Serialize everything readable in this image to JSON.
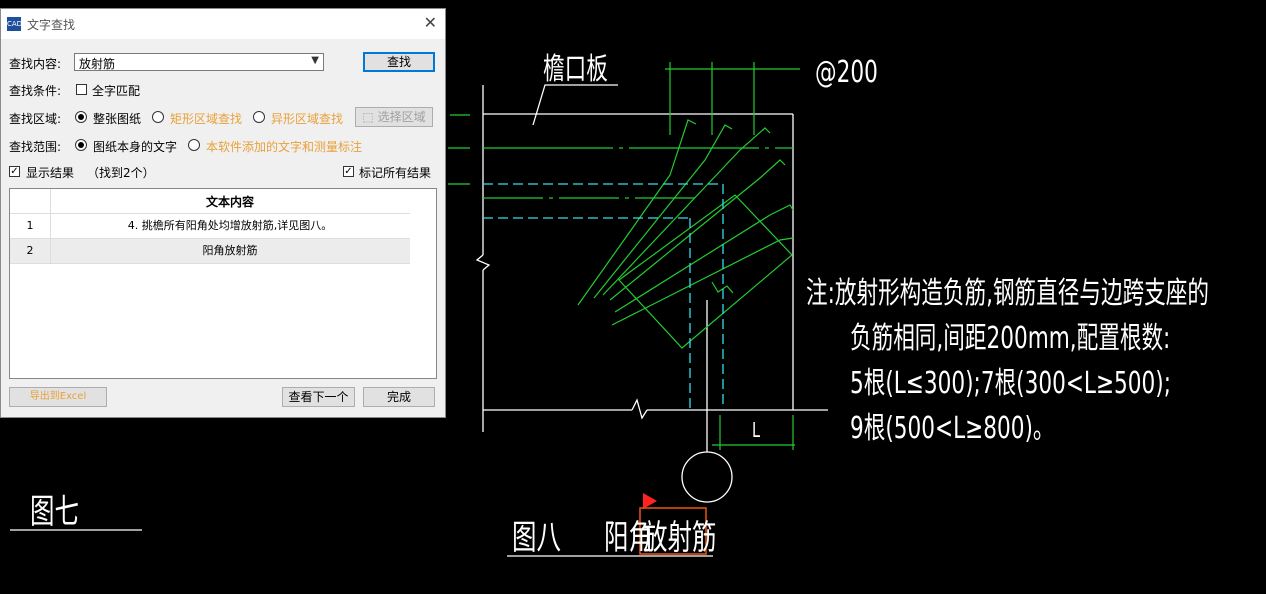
{
  "dialog": {
    "title": "文字查找",
    "app_icon_text": "CAD",
    "find_label": "查找内容:",
    "find_value": "放射筋",
    "find_button": "查找",
    "condition_label": "查找条件:",
    "whole_word": "全字匹配",
    "area_label": "查找区域:",
    "area_whole": "整张图纸",
    "area_rect": "矩形区域查找",
    "area_irregular": "异形区域查找",
    "select_area_button": "选择区域",
    "scope_label": "查找范围:",
    "scope_drawing": "图纸本身的文字",
    "scope_added": "本软件添加的文字和测量标注",
    "show_results": "显示结果",
    "found_count": "（找到2个）",
    "mark_all": "标记所有结果",
    "table_header": "文本内容",
    "rows": [
      {
        "num": "1",
        "text": "4. 挑檐所有阳角处均增放射筋,详见图八。"
      },
      {
        "num": "2",
        "text": "阳角放射筋"
      }
    ],
    "export_button": "导出到Excel",
    "next_button": "查看下一个",
    "done_button": "完成"
  },
  "drawing": {
    "eave_label": "檐口板",
    "spacing_label": "@200",
    "note_line1": "注:放射形构造负筋,钢筋直径与边跨支座的",
    "note_line2": "负筋相同,间距200mm,配置根数:",
    "note_line3": "5根(L≤300);7根(300<L≥500);",
    "note_line4": "9根(500<L≥800)。",
    "dim_L": "L",
    "fig7": "图七",
    "fig8": "图八",
    "fig8_title_a": "阳角",
    "fig8_title_b": "放射筋",
    "colors": {
      "green": "#22cc33",
      "cyan": "#33ddee",
      "white": "#ffffff",
      "marker": "#ff2222",
      "highlight": "#e05010"
    }
  }
}
